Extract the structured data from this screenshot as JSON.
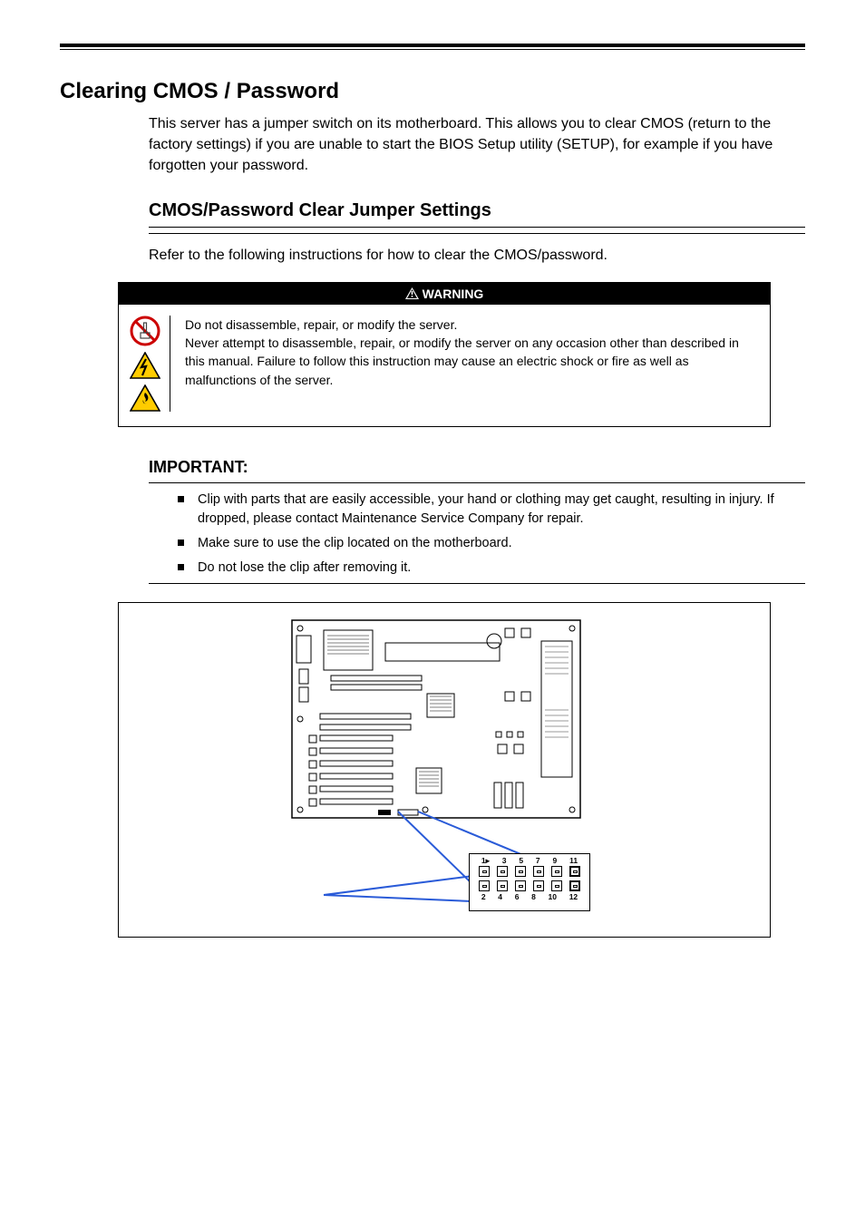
{
  "header": {},
  "section1": {
    "heading": "Clearing CMOS / Password",
    "intro": "This server has a jumper switch on its motherboard. This allows you to clear CMOS (return to the factory settings) if you are unable to start the BIOS Setup utility (SETUP), for example if you have forgotten your password.",
    "sub": "CMOS/Password Clear Jumper Settings",
    "sub_under": "Refer to the following instructions for how to clear the CMOS/password.",
    "important": "IMPORTANT:",
    "bullets": [
      "Clip with parts that are easily accessible, your hand or clothing may get caught, resulting in injury. If dropped, please contact Maintenance Service Company for repair.",
      "Make sure to use the clip located on the motherboard.",
      "Do not lose the clip after removing it."
    ]
  },
  "callout": {
    "label": "WARNING",
    "text": "Do not disassemble, repair, or modify the server.\nNever attempt to disassemble, repair, or modify the server on any occasion other than described in this manual. Failure to follow this instruction may cause an electric shock or fire as well as malfunctions of the server."
  },
  "figure": {
    "pins_top": [
      "1▸",
      "3",
      "5",
      "7",
      "9",
      "11"
    ],
    "pins_bottom": [
      "2",
      "4",
      "6",
      "8",
      "10",
      "12"
    ]
  }
}
